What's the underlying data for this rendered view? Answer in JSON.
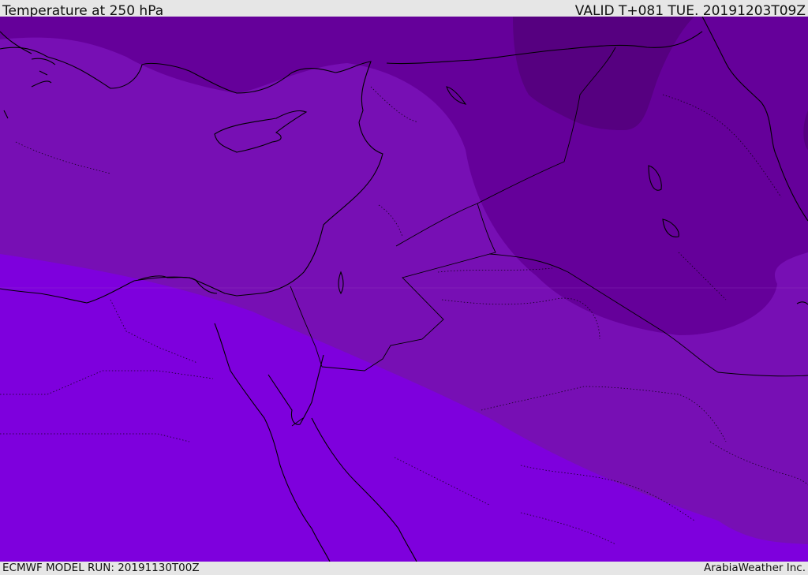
{
  "header": {
    "title": "Temperature at 250 hPa",
    "valid_time": "VALID T+081 TUE. 20191203T09Z"
  },
  "footer": {
    "model_run": "ECMWF MODEL RUN: 20191130T00Z",
    "credit": "ArabiaWeather Inc."
  },
  "map": {
    "field": "temperature",
    "pressure_level_hpa": 250,
    "region": "Eastern Mediterranean / Middle East",
    "temperature_bands": [
      {
        "band": "coldest",
        "color": "#560080"
      },
      {
        "band": "very-cold",
        "color": "#65009a"
      },
      {
        "band": "cold",
        "color": "#770fb4"
      },
      {
        "band": "warmer",
        "color": "#7e00dd"
      }
    ],
    "coastline_color": "#000000",
    "border_style": "dotted"
  }
}
